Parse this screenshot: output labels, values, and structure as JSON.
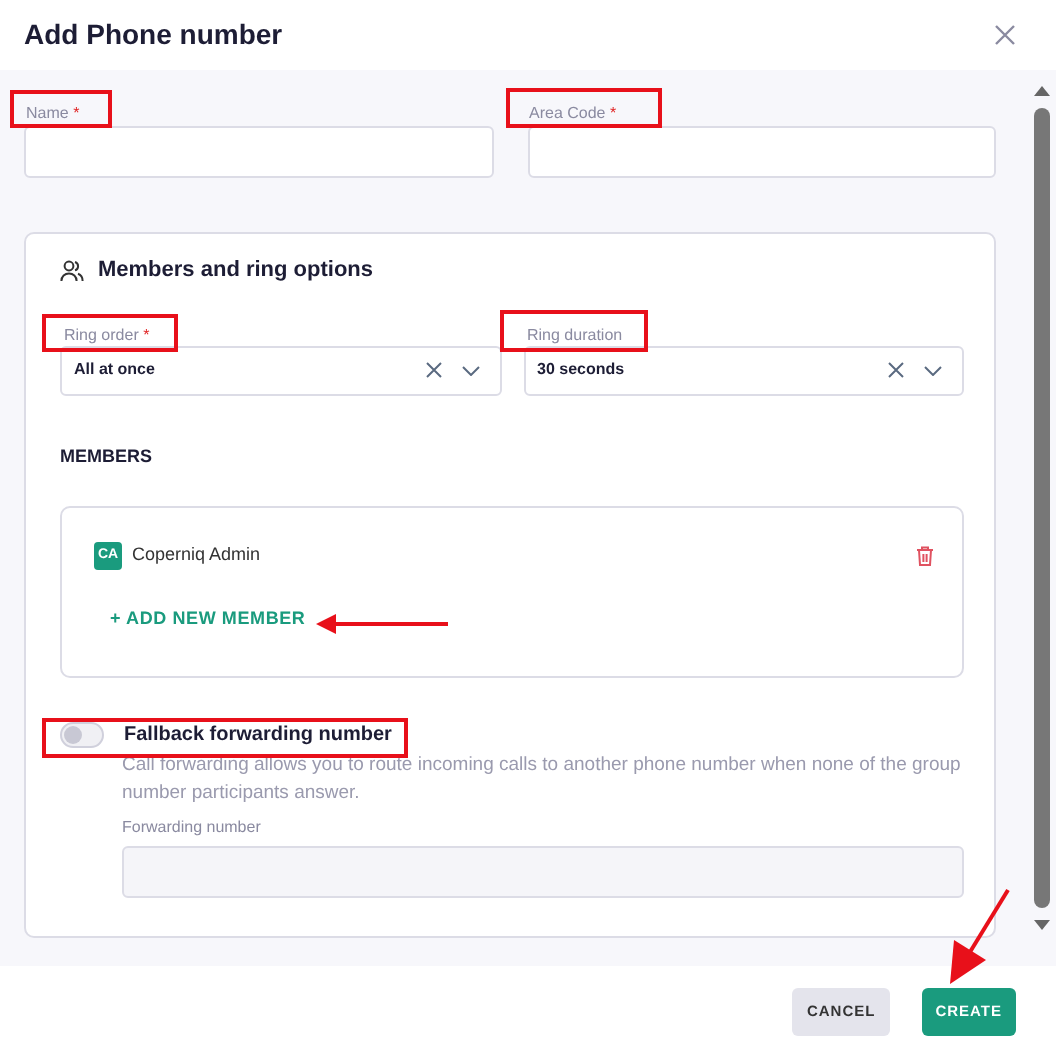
{
  "dialog": {
    "title": "Add Phone number"
  },
  "fields": [
    {
      "label": "Name",
      "required_mark": "*"
    },
    {
      "label": "Area Code",
      "required_mark": "*"
    }
  ],
  "ring_section": {
    "title": "Members and ring options",
    "selects": [
      {
        "label": "Ring order",
        "required_mark": "*",
        "value": "All at once"
      },
      {
        "label": "Ring duration",
        "value": "30 seconds"
      }
    ],
    "members_heading": "MEMBERS",
    "members": [
      {
        "initials": "CA",
        "name": "Coperniq Admin"
      }
    ],
    "add_member": "+ ADD NEW MEMBER"
  },
  "fallback": {
    "label": "Fallback forwarding number",
    "on": false,
    "description": "Call forwarding allows you to route incoming calls to another phone number when none of the group number participants answer.",
    "field_label": "Forwarding number"
  },
  "buttons": [
    {
      "label": "CANCEL",
      "kind": "secondary"
    },
    {
      "label": "CREATE",
      "kind": "primary"
    }
  ]
}
